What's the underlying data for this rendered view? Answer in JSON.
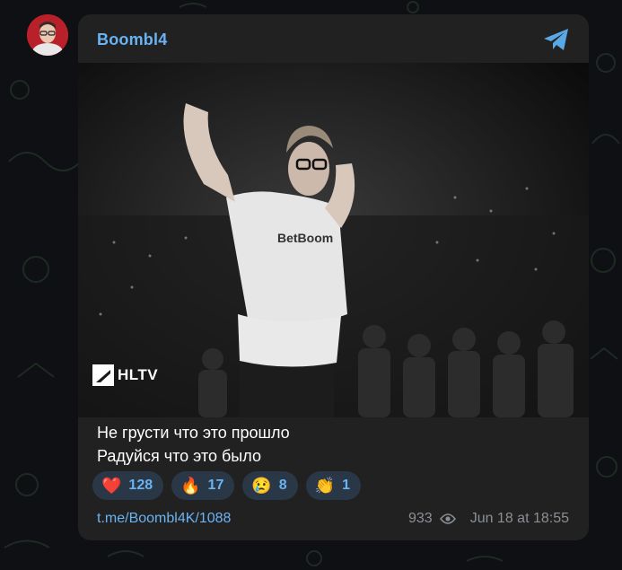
{
  "channel": {
    "name": "Boombl4"
  },
  "photo": {
    "watermark": "HLTV",
    "shirt_text": "BetBoom"
  },
  "message": {
    "lines": [
      "Не грусти что это прошло",
      "Радуйся что это было"
    ]
  },
  "reactions": [
    {
      "emoji": "❤️",
      "count": "128"
    },
    {
      "emoji": "🔥",
      "count": "17"
    },
    {
      "emoji": "😢",
      "count": "8"
    },
    {
      "emoji": "👏",
      "count": "1"
    }
  ],
  "footer": {
    "link": "t.me/Boombl4K/1088",
    "views": "933",
    "timestamp": "Jun 18 at 18:55"
  },
  "icons": {
    "app": "telegram-plane-icon",
    "views": "eye-icon"
  },
  "colors": {
    "accent": "#6ab3f3",
    "bubble": "#212121",
    "reaction_bg": "#2a3746"
  }
}
